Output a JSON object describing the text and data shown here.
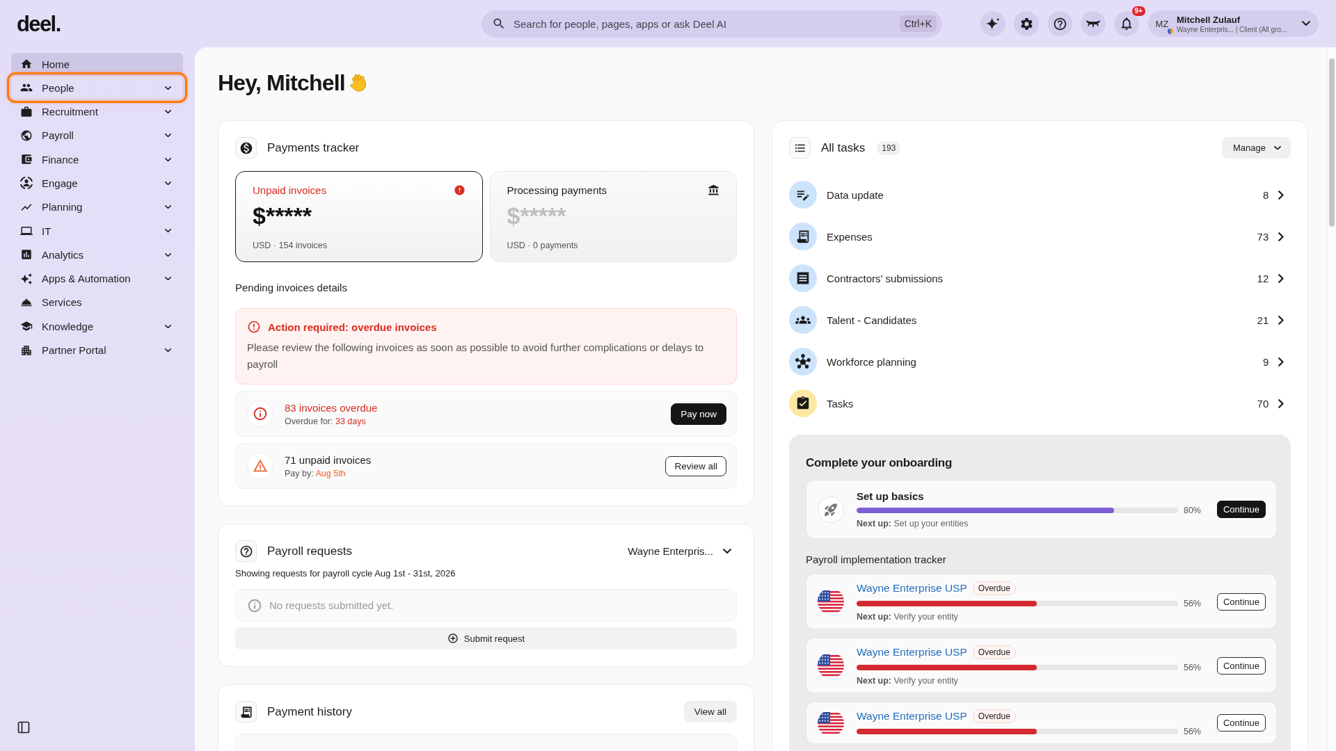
{
  "topbar": {
    "logo": "deel.",
    "search": {
      "placeholder": "Search for people, pages, apps or ask Deel AI",
      "shortcut": "Ctrl+K"
    },
    "notification_badge": "9+",
    "user": {
      "initials": "MZ",
      "name": "Mitchell Zulauf",
      "subtitle": "Wayne Enterpris... | Client (All gro..."
    }
  },
  "sidebar": {
    "items": [
      {
        "label": "Home",
        "selected": true,
        "focused": false,
        "expandable": false
      },
      {
        "label": "People",
        "selected": false,
        "focused": true,
        "expandable": true
      },
      {
        "label": "Recruitment",
        "selected": false,
        "focused": false,
        "expandable": true
      },
      {
        "label": "Payroll",
        "selected": false,
        "focused": false,
        "expandable": true
      },
      {
        "label": "Finance",
        "selected": false,
        "focused": false,
        "expandable": true
      },
      {
        "label": "Engage",
        "selected": false,
        "focused": false,
        "expandable": true
      },
      {
        "label": "Planning",
        "selected": false,
        "focused": false,
        "expandable": true
      },
      {
        "label": "IT",
        "selected": false,
        "focused": false,
        "expandable": true
      },
      {
        "label": "Analytics",
        "selected": false,
        "focused": false,
        "expandable": true
      },
      {
        "label": "Apps & Automation",
        "selected": false,
        "focused": false,
        "expandable": true
      },
      {
        "label": "Services",
        "selected": false,
        "focused": false,
        "expandable": false
      },
      {
        "label": "Knowledge",
        "selected": false,
        "focused": false,
        "expandable": true
      },
      {
        "label": "Partner Portal",
        "selected": false,
        "focused": false,
        "expandable": true
      }
    ]
  },
  "greeting": "Hey, Mitchell",
  "payments_tracker": {
    "title": "Payments tracker",
    "cards": [
      {
        "kind": "unpaid",
        "title": "Unpaid invoices",
        "amount": "$*****",
        "detail": "USD · 154 invoices",
        "selected": true
      },
      {
        "kind": "processing",
        "title": "Processing payments",
        "amount": "$*****",
        "detail": "USD · 0 payments",
        "selected": false
      }
    ],
    "pending_title": "Pending invoices details",
    "alert": {
      "title": "Action required: overdue invoices",
      "message": "Please review the following invoices as soon as possible to avoid further complications or delays to payroll"
    },
    "rows": [
      {
        "kind": "overdue",
        "title": "83 invoices overdue",
        "label": "Overdue for:",
        "value": "33 days",
        "button": "Pay now"
      },
      {
        "kind": "upcoming",
        "title": "71 unpaid invoices",
        "label": "Pay by:",
        "value": "Aug 5th",
        "button": "Review all"
      }
    ]
  },
  "payroll_requests": {
    "title": "Payroll requests",
    "entity": "Wayne Enterpris...",
    "cycle": "Showing requests for payroll cycle Aug 1st - 31st, 2026",
    "empty_message": "No requests submitted yet.",
    "button": "Submit request"
  },
  "payment_history": {
    "title": "Payment history",
    "button": "View all"
  },
  "all_tasks": {
    "title": "All tasks",
    "count": "193",
    "manage": "Manage",
    "items": [
      {
        "label": "Data update",
        "count": "8",
        "color": "#cce3fc"
      },
      {
        "label": "Expenses",
        "count": "73",
        "color": "#cce3fc"
      },
      {
        "label": "Contractors' submissions",
        "count": "12",
        "color": "#cce3fc"
      },
      {
        "label": "Talent - Candidates",
        "count": "21",
        "color": "#cce3fc"
      },
      {
        "label": "Workforce planning",
        "count": "9",
        "color": "#cce3fc"
      },
      {
        "label": "Tasks",
        "count": "70",
        "color": "#fde8a3"
      }
    ]
  },
  "onboarding": {
    "title": "Complete your onboarding",
    "setup": {
      "title": "Set up basics",
      "level": 0.8,
      "percent": "80%",
      "next": "**Next up:** Set up your entities",
      "button": "Continue"
    },
    "tracker_title": "Payroll implementation tracker",
    "trackers": [
      {
        "name": "Wayne Enterprise USP",
        "status": "Overdue",
        "level": 0.56,
        "percent": "56%",
        "next": "**Next up:** Verify your entity",
        "button": "Continue"
      },
      {
        "name": "Wayne Enterprise USP",
        "status": "Overdue",
        "level": 0.56,
        "percent": "56%",
        "next": "**Next up:** Verify your entity",
        "button": "Continue"
      },
      {
        "name": "Wayne Enterprise USP",
        "status": "Overdue",
        "level": 0.56,
        "percent": "56%",
        "button": "Continue"
      }
    ]
  }
}
